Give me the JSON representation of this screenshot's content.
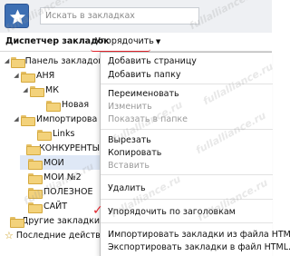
{
  "search": {
    "placeholder": "Искать в закладках"
  },
  "toolbar": {
    "title": "Диспетчер закладок",
    "sort_label": "Упорядочить"
  },
  "tree": {
    "items": [
      {
        "label": "Панель закладок"
      },
      {
        "label": "АНЯ"
      },
      {
        "label": "МК"
      },
      {
        "label": "Новая"
      },
      {
        "label": "Импортирова"
      },
      {
        "label": "Links"
      },
      {
        "label": "КОНКУРЕНТЫ"
      },
      {
        "label": "МОИ"
      },
      {
        "label": "МОИ №2"
      },
      {
        "label": "ПОЛЕЗНОЕ"
      },
      {
        "label": "САЙТ"
      },
      {
        "label": "Другие закладки"
      },
      {
        "label": "Последние действ"
      }
    ]
  },
  "menu": {
    "items": [
      {
        "label": "Добавить страницу"
      },
      {
        "label": "Добавить папку"
      },
      {
        "label": "Переименовать"
      },
      {
        "label": "Изменить"
      },
      {
        "label": "Показать в папке"
      },
      {
        "label": "Вырезать"
      },
      {
        "label": "Копировать"
      },
      {
        "label": "Вставить"
      },
      {
        "label": "Удалить"
      },
      {
        "label": "Упорядочить по заголовкам"
      },
      {
        "label": "Импортировать закладки из файла HTML..."
      },
      {
        "label": "Экспортировать закладки в файл HTML..."
      }
    ]
  },
  "watermark": {
    "text": "fullalliance.ru"
  },
  "colors": {
    "accent_red": "#e0242c",
    "folder": "#f3d27b",
    "selected_row": "#dfe8f6",
    "logo": "#3d6fb3"
  }
}
